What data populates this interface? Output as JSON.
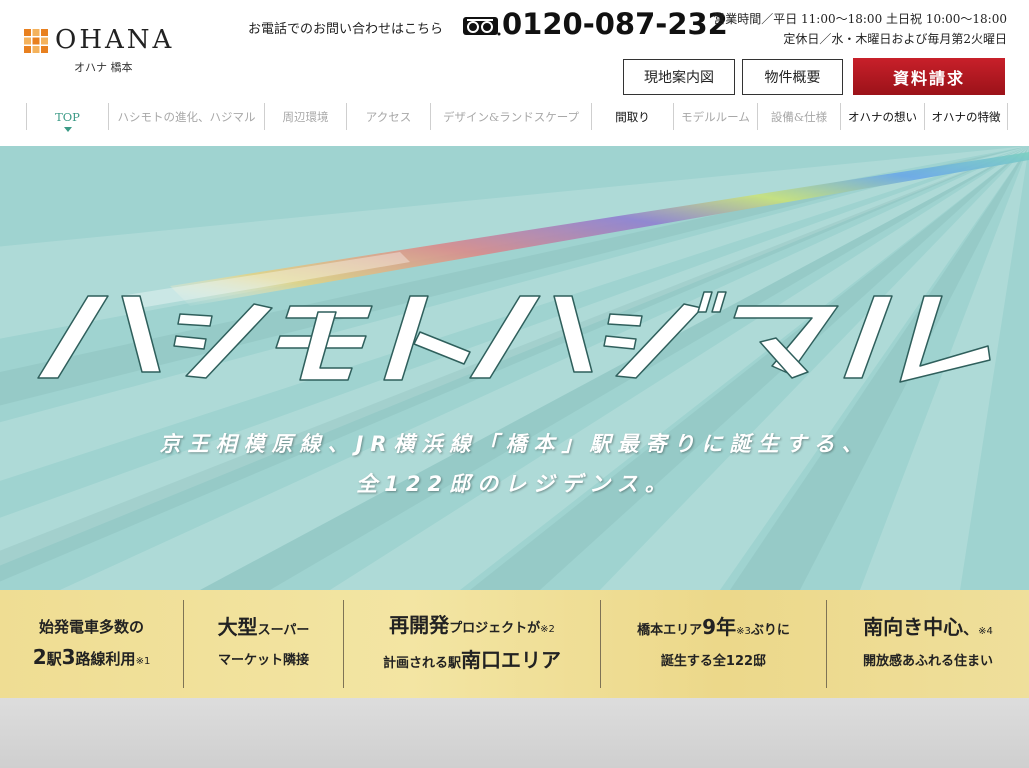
{
  "brand": {
    "logo_text": "OHANA",
    "logo_sub": "オハナ 橋本",
    "colors": {
      "mark": "#e8801f",
      "accent": "#3b9a86",
      "request": "#b5141e"
    }
  },
  "contact": {
    "phone_label": "お電話でのお問い合わせはこちら",
    "free_icon": "free-dial-icon",
    "phone_number": "0120-087-232",
    "hours_line1": "営業時間／平日 11:00〜18:00 土日祝 10:00〜18:00",
    "hours_line2": "定休日／水・木曜日および毎月第2火曜日"
  },
  "buttons": {
    "map": "現地案内図",
    "overview": "物件概要",
    "request": "資料請求"
  },
  "nav": [
    {
      "label": "TOP",
      "state": "active"
    },
    {
      "label": "ハシモトの進化、ハジマル",
      "state": "gray"
    },
    {
      "label": "周辺環境",
      "state": "gray"
    },
    {
      "label": "アクセス",
      "state": "gray"
    },
    {
      "label": "デザイン&ランドスケープ",
      "state": "gray"
    },
    {
      "label": "間取り",
      "state": "dark"
    },
    {
      "label": "モデルルーム",
      "state": "gray"
    },
    {
      "label": "設備&仕様",
      "state": "gray"
    },
    {
      "label": "オハナの想い",
      "state": "dark"
    },
    {
      "label": "オハナの特徴",
      "state": "dark"
    }
  ],
  "hero": {
    "title": "ハシモトハジマル",
    "subtitle_line1": "京王相模原線、JR横浜線「橋本」駅最寄りに誕生する、",
    "subtitle_line2": "全122邸のレジデンス。"
  },
  "features": {
    "f1": {
      "l1": "始発電車多数の",
      "l2a": "2",
      "l2b": "駅",
      "l2c": "3",
      "l2d": "路線利用",
      "note": "※1"
    },
    "f2": {
      "l1a": "大型",
      "l1b": "スーパー",
      "l2": "マーケット隣接"
    },
    "f3": {
      "l1a": "再開発",
      "l1b": "プロジェクトが",
      "note": "※2",
      "l2a": "計画される駅",
      "l2b": "南口エリア"
    },
    "f4": {
      "l1a": "橋本エリア",
      "l1b": "9年",
      "note": "※3",
      "l1c": "ぶりに",
      "l2": "誕生する全122邸"
    },
    "f5": {
      "l1a": "南向き中心",
      "l1b": "、",
      "note": "※4",
      "l2": "開放感あふれる住まい"
    }
  }
}
